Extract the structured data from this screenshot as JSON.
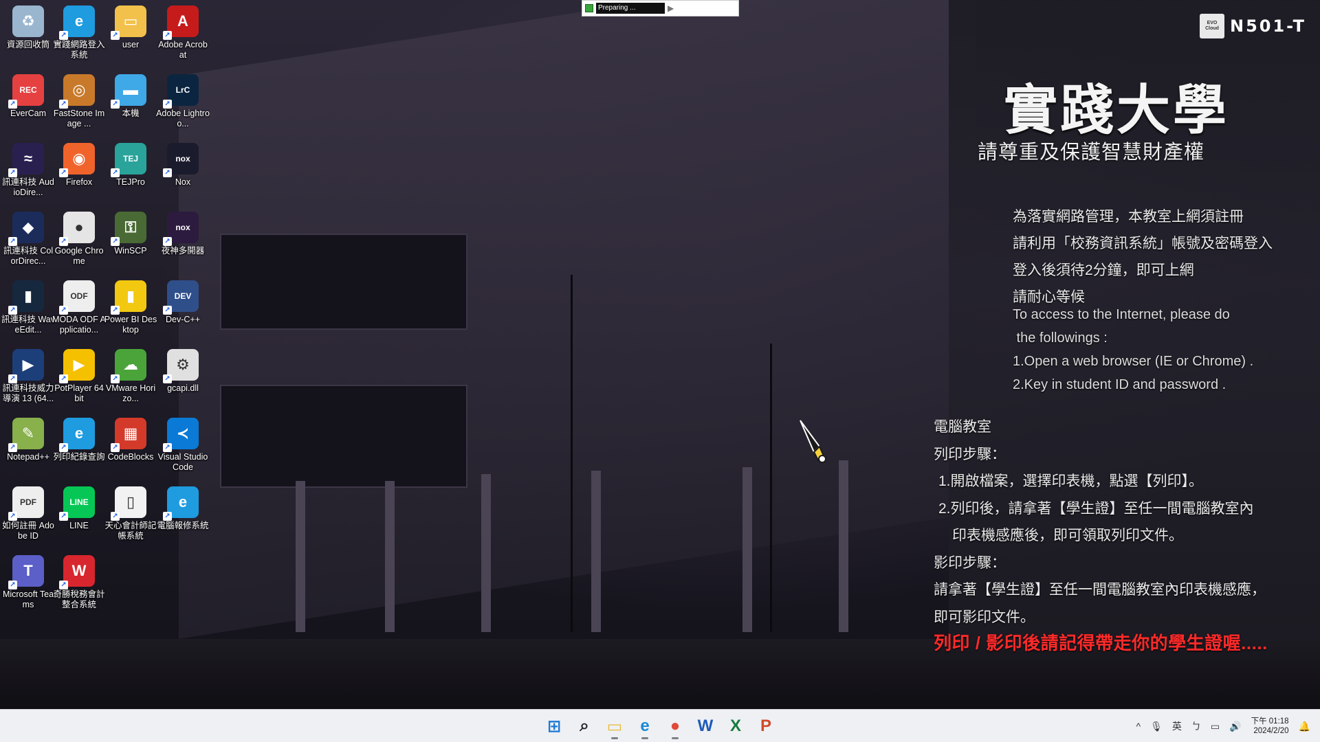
{
  "top_progress": {
    "label": "Preparing ..."
  },
  "brand": {
    "logo_line1": "EVO",
    "logo_line2": "Cloud",
    "room": "N501-T"
  },
  "right_panel": {
    "university": "實踐大學",
    "ip_notice": "請尊重及保護智慧財產權",
    "notice_zh": [
      "為落實網路管理，本教室上網須註冊",
      "請利用「校務資訊系統」帳號及密碼登入",
      "登入後須待2分鐘，即可上網",
      "請耐心等候"
    ],
    "notice_en": [
      "To access to the Internet, please do",
      " the followings :",
      "1.Open a web browser (IE or Chrome) .",
      "2.Key in student ID and password ."
    ],
    "lab_title": "電腦教室",
    "print_title": "列印步驟：",
    "print_step1": "1.開啟檔案，選擇印表機，點選【列印】。",
    "print_step2a": "2.列印後，請拿著【學生證】至任一間電腦教室內",
    "print_step2b": "印表機感應後，即可領取列印文件。",
    "copy_title": "影印步驟：",
    "copy_step1": "請拿著【學生證】至任一間電腦教室內印表機感應，",
    "copy_step2": "即可影印文件。",
    "warning": "列印 / 影印後請記得帶走你的學生證喔....."
  },
  "desktop_icons": [
    {
      "name": "recycle-bin-icon",
      "label": "資源回收筒",
      "bg": "#9ab6cf",
      "glyph": "♻"
    },
    {
      "name": "edge-login-icon",
      "label": "實踐網路登入系統",
      "bg": "#1f9be0",
      "glyph": "e"
    },
    {
      "name": "user-folder-icon",
      "label": "user",
      "bg": "#f2c14b",
      "glyph": "▭"
    },
    {
      "name": "adobe-acrobat-icon",
      "label": "Adobe Acrobat",
      "bg": "#c61b1b",
      "glyph": "A"
    },
    {
      "name": "evercam-icon",
      "label": "EverCam",
      "bg": "#e64141",
      "glyph": "REC"
    },
    {
      "name": "faststone-icon",
      "label": "FastStone Image ...",
      "bg": "#c87a2a",
      "glyph": "◎"
    },
    {
      "name": "this-pc-icon",
      "label": "本機",
      "bg": "#3fa8e6",
      "glyph": "▬"
    },
    {
      "name": "lightroom-icon",
      "label": "Adobe Lightroo...",
      "bg": "#0b2540",
      "glyph": "LrC"
    },
    {
      "name": "audiodirector-icon",
      "label": "訊連科技 AudioDire...",
      "bg": "#2a2050",
      "glyph": "≈"
    },
    {
      "name": "firefox-icon",
      "label": "Firefox",
      "bg": "#f0642c",
      "glyph": "◉"
    },
    {
      "name": "tejpro-icon",
      "label": "TEJPro",
      "bg": "#2aa39a",
      "glyph": "TEJ"
    },
    {
      "name": "nox-icon",
      "label": "Nox",
      "bg": "#1b1b2e",
      "glyph": "nox"
    },
    {
      "name": "colordirector-icon",
      "label": "訊連科技 ColorDirec...",
      "bg": "#1b2c5a",
      "glyph": "◆"
    },
    {
      "name": "chrome-icon",
      "label": "Google Chrome",
      "bg": "#e5e5e5",
      "glyph": "●"
    },
    {
      "name": "winscp-icon",
      "label": "WinSCP",
      "bg": "#4a6a35",
      "glyph": "⚿"
    },
    {
      "name": "nox-multi-icon",
      "label": "夜神多開器",
      "bg": "#2c1b3e",
      "glyph": "nox"
    },
    {
      "name": "wavedirector-icon",
      "label": "訊連科技 WaveEdit...",
      "bg": "#16283e",
      "glyph": "▮"
    },
    {
      "name": "moda-odf-icon",
      "label": "MODA ODF Applicatio...",
      "bg": "#eeeeee",
      "glyph": "ODF"
    },
    {
      "name": "powerbi-icon",
      "label": "Power BI Desktop",
      "bg": "#f2c811",
      "glyph": "▮"
    },
    {
      "name": "devcpp-icon",
      "label": "Dev-C++",
      "bg": "#2f4f8a",
      "glyph": "DEV"
    },
    {
      "name": "powerdirector-icon",
      "label": "訊連科技威力導演 13 (64...",
      "bg": "#1c3f7a",
      "glyph": "▶"
    },
    {
      "name": "potplayer-icon",
      "label": "PotPlayer 64 bit",
      "bg": "#f5c000",
      "glyph": "▶"
    },
    {
      "name": "vmware-icon",
      "label": "VMware Horizo...",
      "bg": "#4aa43a",
      "glyph": "☁"
    },
    {
      "name": "gcapi-dll-icon",
      "label": "gcapi.dll",
      "bg": "#e0e0e0",
      "glyph": "⚙"
    },
    {
      "name": "notepadpp-icon",
      "label": "Notepad++",
      "bg": "#88b04b",
      "glyph": "✎"
    },
    {
      "name": "print-record-icon",
      "label": "列印紀錄查詢",
      "bg": "#1f9be0",
      "glyph": "e"
    },
    {
      "name": "codeblocks-icon",
      "label": "CodeBlocks",
      "bg": "#d43a2a",
      "glyph": "▦"
    },
    {
      "name": "vscode-icon",
      "label": "Visual Studio Code",
      "bg": "#0a7ad6",
      "glyph": "≺"
    },
    {
      "name": "adobe-id-pdf-icon",
      "label": "如何註冊 Adobe ID",
      "bg": "#eeeeee",
      "glyph": "PDF"
    },
    {
      "name": "line-icon",
      "label": "LINE",
      "bg": "#06c755",
      "glyph": "LINE"
    },
    {
      "name": "accounting-system-icon",
      "label": "天心會計師記帳系統",
      "bg": "#f2f2f2",
      "glyph": "▯"
    },
    {
      "name": "repair-system-icon",
      "label": "電腦報修系統",
      "bg": "#1f9be0",
      "glyph": "e"
    },
    {
      "name": "teams-icon",
      "label": "Microsoft Teams",
      "bg": "#5b5fc7",
      "glyph": "T"
    },
    {
      "name": "tax-accounting-icon",
      "label": "奇勝稅務會計整合系統",
      "bg": "#d8262e",
      "glyph": "W"
    }
  ],
  "taskbar": {
    "apps": [
      {
        "name": "start-button",
        "glyph": "⊞",
        "color": "#1a78d6"
      },
      {
        "name": "search-button",
        "glyph": "⌕",
        "color": "#222"
      },
      {
        "name": "file-explorer-button",
        "glyph": "▭",
        "color": "#e8b93a"
      },
      {
        "name": "edge-taskbar-button",
        "glyph": "e",
        "color": "#1a8ad6"
      },
      {
        "name": "chrome-taskbar-button",
        "glyph": "●",
        "color": "#e04a3a"
      },
      {
        "name": "word-taskbar-button",
        "glyph": "W",
        "color": "#1f5ab8"
      },
      {
        "name": "excel-taskbar-button",
        "glyph": "X",
        "color": "#187a3e"
      },
      {
        "name": "powerpoint-taskbar-button",
        "glyph": "P",
        "color": "#cf4a2a"
      }
    ],
    "tray": {
      "chevron": "^",
      "mic": "🎙",
      "ime": "英",
      "ime_mode": "ㄅ",
      "network": "▭",
      "volume": "🔊",
      "time": "下午 01:18",
      "date": "2024/2/20",
      "notification": "🔔"
    }
  }
}
